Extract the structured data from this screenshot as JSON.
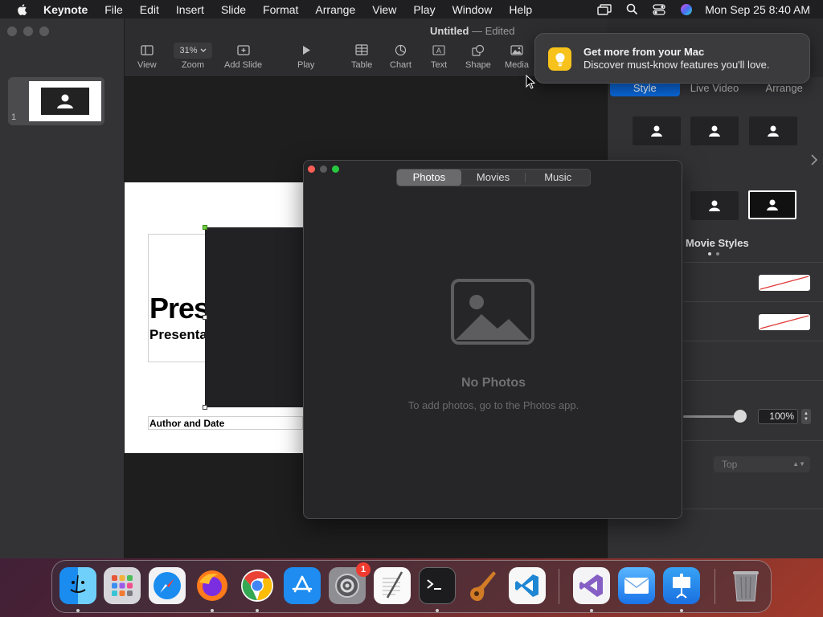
{
  "menubar": {
    "app_name": "Keynote",
    "items": [
      "File",
      "Edit",
      "Insert",
      "Slide",
      "Format",
      "Arrange",
      "View",
      "Play",
      "Window",
      "Help"
    ],
    "clock": "Mon Sep 25  8:40 AM"
  },
  "window": {
    "doc_name": "Untitled",
    "doc_status": "— Edited"
  },
  "toolbar": {
    "view": "View",
    "zoom_value": "31%",
    "zoom": "Zoom",
    "add_slide": "Add Slide",
    "play": "Play",
    "table": "Table",
    "chart": "Chart",
    "text": "Text",
    "shape": "Shape",
    "media": "Media"
  },
  "navigator": {
    "slide_number": "1"
  },
  "slide": {
    "title": "Pres",
    "subtitle": "Presenta",
    "author": "Author and Date"
  },
  "inspector": {
    "tabs": [
      "Style",
      "Live Video",
      "Arrange"
    ],
    "active_tab": "Style",
    "movie_styles_label": "Movie Styles",
    "opacity_value": "100%",
    "position_select": "Top"
  },
  "media_browser": {
    "tabs": [
      "Photos",
      "Movies",
      "Music"
    ],
    "active_tab": "Photos",
    "empty_title": "No Photos",
    "empty_message": "To add photos, go to the Photos app."
  },
  "notification": {
    "title": "Get more from your Mac",
    "body": "Discover must-know features you'll love."
  },
  "dock": {
    "apps": [
      "Finder",
      "Launchpad",
      "Safari",
      "Firefox",
      "Chrome",
      "App Store",
      "System Settings",
      "TextEdit",
      "Terminal",
      "GarageBand",
      "VS Code",
      "Visual Studio",
      "Mail",
      "Keynote",
      "Trash"
    ],
    "settings_badge": "1"
  },
  "colors": {
    "accent": "#0a67d8",
    "notification_icon": "#f7c21b",
    "badge": "#ef3b30"
  }
}
